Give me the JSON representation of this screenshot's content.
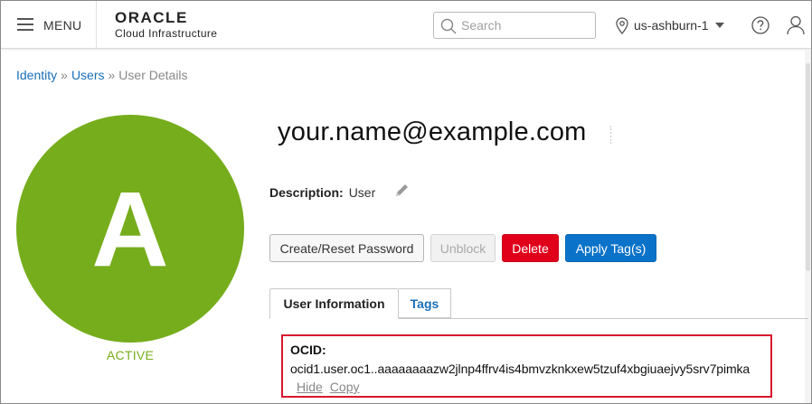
{
  "header": {
    "menu_label": "MENU",
    "logo_title": "ORACLE",
    "logo_subtitle": "Cloud Infrastructure",
    "search_placeholder": "Search",
    "region": "us-ashburn-1",
    "icons": [
      "hamburger-icon",
      "search-icon",
      "location-pin-icon",
      "chevron-down-icon",
      "help-icon",
      "user-icon"
    ]
  },
  "breadcrumb": {
    "items": [
      "Identity",
      "Users",
      "User Details"
    ],
    "separator": "»"
  },
  "user": {
    "avatar_letter": "A",
    "status": "ACTIVE",
    "name": "your.name@example.com",
    "description_label": "Description:",
    "description_value": "User"
  },
  "actions": {
    "reset_password": "Create/Reset Password",
    "unblock": "Unblock",
    "delete": "Delete",
    "apply_tags": "Apply Tag(s)"
  },
  "tabs": [
    {
      "label": "User Information",
      "active": true
    },
    {
      "label": "Tags",
      "active": false
    }
  ],
  "ocid": {
    "label": "OCID:",
    "value": "ocid1.user.oc1..aaaaaaaazw2jlnp4ffrv4is4bmvzknkxew5tzuf4xbgiuaejvy5srv7pimka",
    "hide_link": "Hide",
    "copy_link": "Copy"
  },
  "colors": {
    "avatar": "#76ad1c",
    "link": "#1a6fb8",
    "delete": "#e1001a",
    "primary": "#0a73c9",
    "highlight_border": "#d7172f"
  }
}
